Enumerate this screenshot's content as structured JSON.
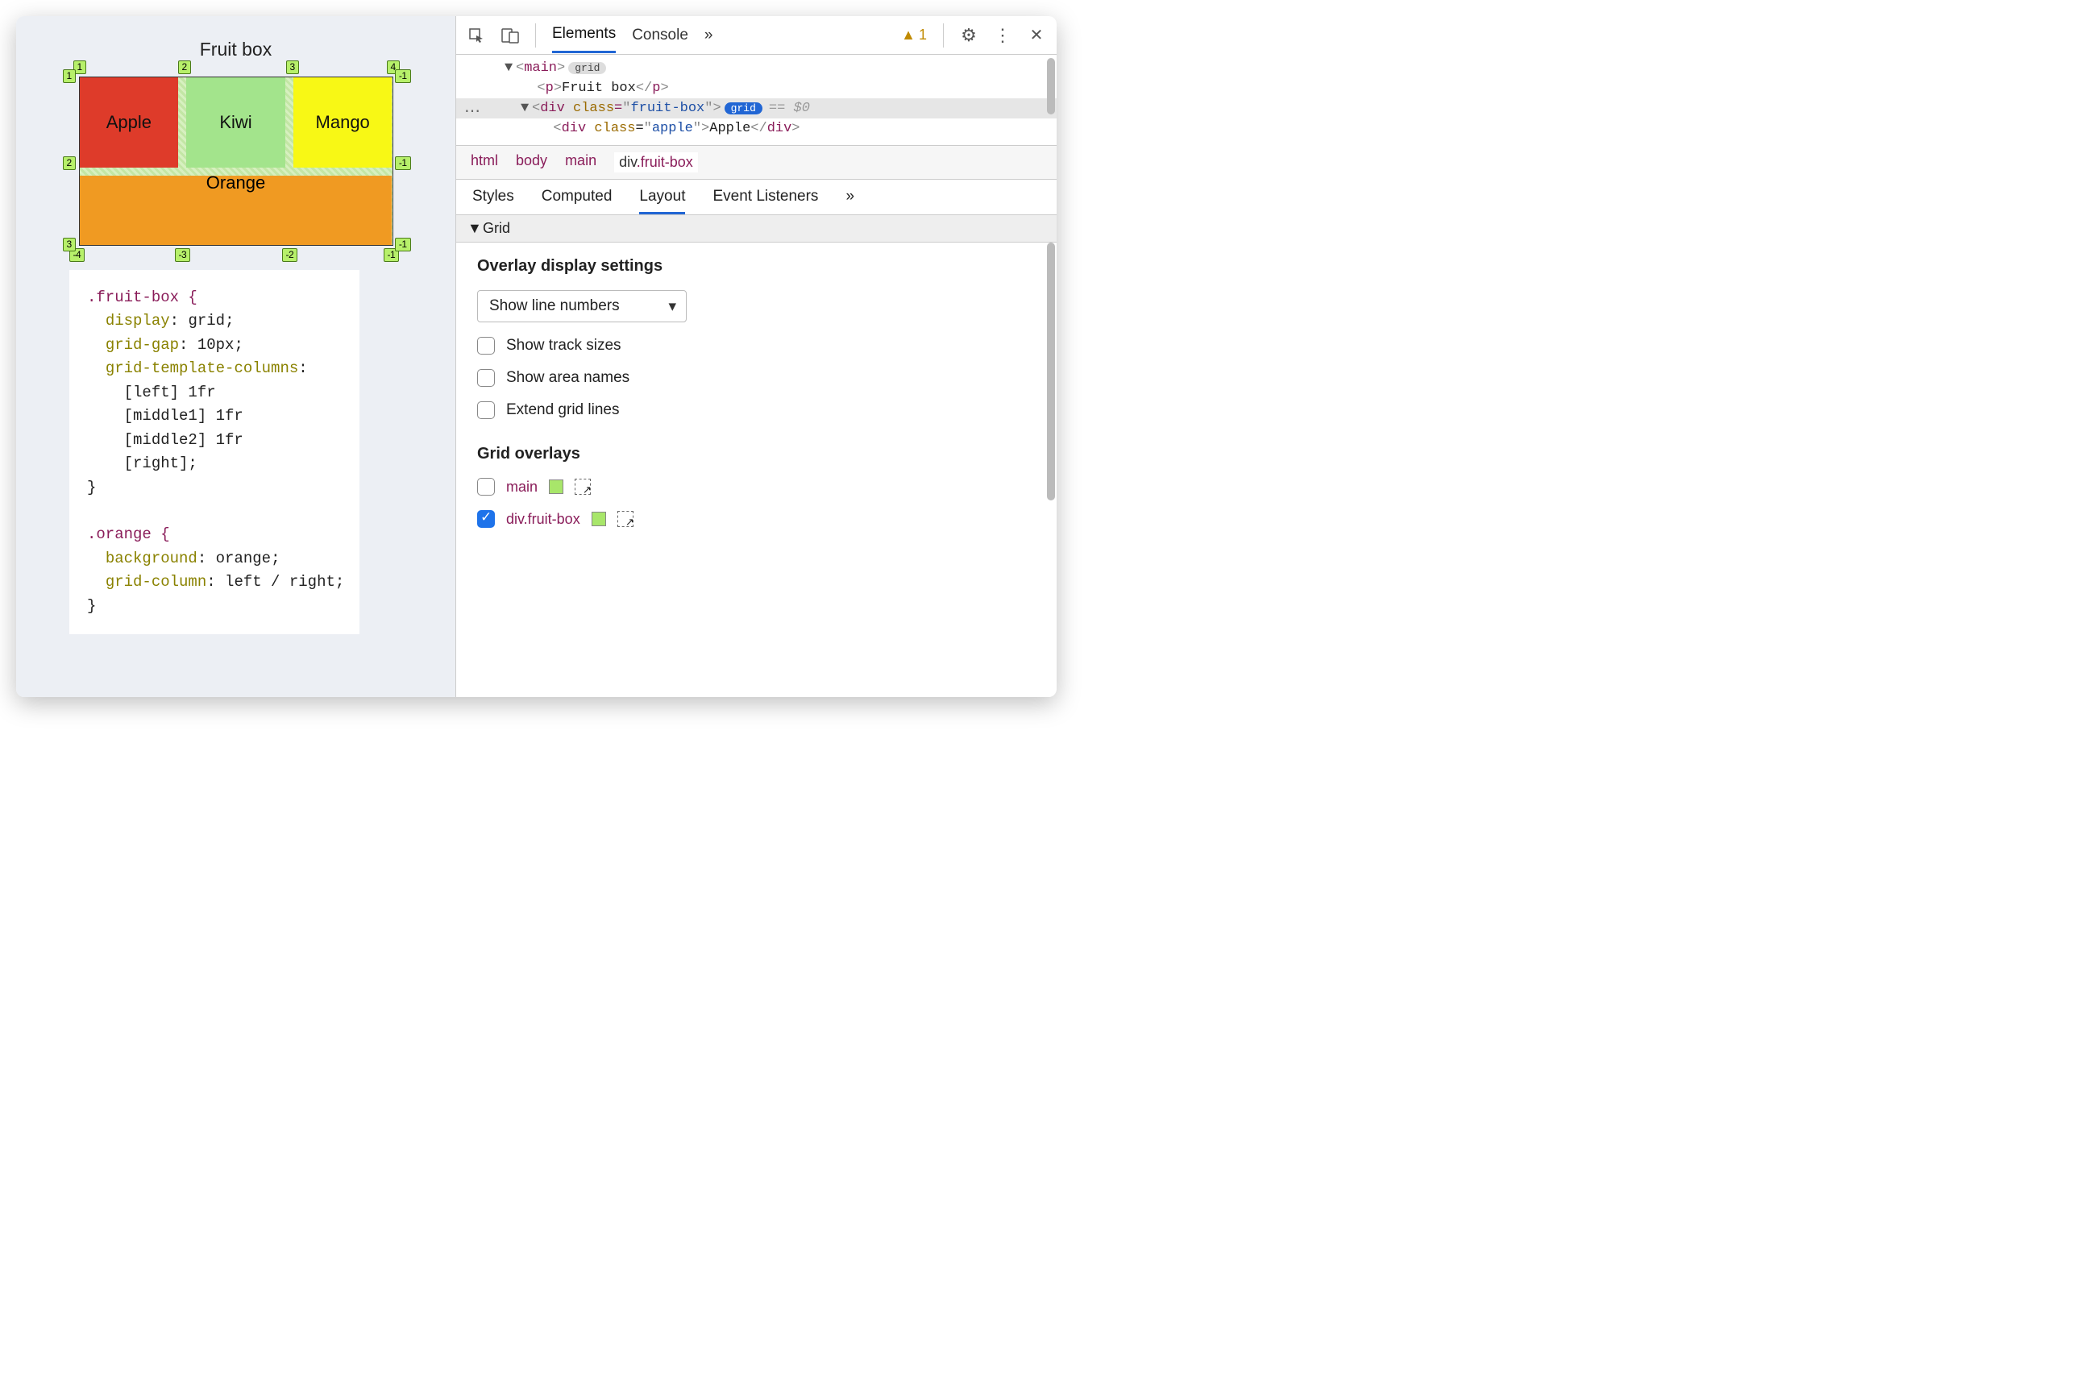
{
  "page": {
    "title": "Fruit box",
    "cells": {
      "apple": "Apple",
      "kiwi": "Kiwi",
      "mango": "Mango",
      "orange": "Orange"
    },
    "grid_chips": {
      "top": [
        "1",
        "2",
        "3",
        "4"
      ],
      "bottom": [
        "-4",
        "-3",
        "-2",
        "-1"
      ],
      "left": [
        "1",
        "2",
        "3"
      ],
      "right": [
        "-1",
        "-1",
        "-1"
      ]
    }
  },
  "code": {
    "rule1_selector": ".fruit-box {",
    "rule1_props": [
      {
        "p": "display",
        "v": "grid"
      },
      {
        "p": "grid-gap",
        "v": "10px"
      },
      {
        "p": "grid-template-columns",
        "v": ""
      }
    ],
    "rule1_cols": [
      "[left] 1fr",
      "[middle1] 1fr",
      "[middle2] 1fr",
      "[right];"
    ],
    "rule1_close": "}",
    "rule2_selector": ".orange {",
    "rule2_props": [
      {
        "p": "background",
        "v": "orange"
      },
      {
        "p": "grid-column",
        "v": "left / right"
      }
    ],
    "rule2_close": "}"
  },
  "devtools": {
    "tabs": {
      "elements": "Elements",
      "console": "Console",
      "more": "»"
    },
    "warning_count": "1",
    "dom": {
      "main_tag": "main",
      "main_badge": "grid",
      "p_text": "Fruit box",
      "div_class": "fruit-box",
      "div_badge": "grid",
      "div_ref": "== $0",
      "apple_class": "apple",
      "apple_text": "Apple"
    },
    "breadcrumb": [
      "html",
      "body",
      "main",
      "div.fruit-box"
    ],
    "subtabs": {
      "styles": "Styles",
      "computed": "Computed",
      "layout": "Layout",
      "listeners": "Event Listeners",
      "more": "»"
    },
    "grid_section": "Grid",
    "overlay_settings_header": "Overlay display settings",
    "line_mode_select": "Show line numbers",
    "checks": {
      "track_sizes": "Show track sizes",
      "area_names": "Show area names",
      "extend_lines": "Extend grid lines"
    },
    "overlays_header": "Grid overlays",
    "overlays": [
      {
        "label": "main",
        "checked": false
      },
      {
        "label": "div.fruit-box",
        "checked": true
      }
    ]
  }
}
